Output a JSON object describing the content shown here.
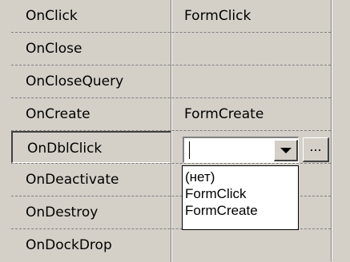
{
  "properties": [
    {
      "name": "OnClick",
      "value": "FormClick"
    },
    {
      "name": "OnClose",
      "value": ""
    },
    {
      "name": "OnCloseQuery",
      "value": ""
    },
    {
      "name": "OnCreate",
      "value": "FormCreate"
    },
    {
      "name": "OnDblClick",
      "value": ""
    },
    {
      "name": "OnDeactivate",
      "value": ""
    },
    {
      "name": "OnDestroy",
      "value": ""
    },
    {
      "name": "OnDockDrop",
      "value": ""
    }
  ],
  "editor": {
    "value": "",
    "ellipsis_label": "..."
  },
  "dropdown": {
    "options": [
      "(нет)",
      "FormClick",
      "FormCreate"
    ]
  },
  "colors": {
    "background": "#d4d0c8",
    "separator": "#808080",
    "list_background": "#ffffff"
  }
}
